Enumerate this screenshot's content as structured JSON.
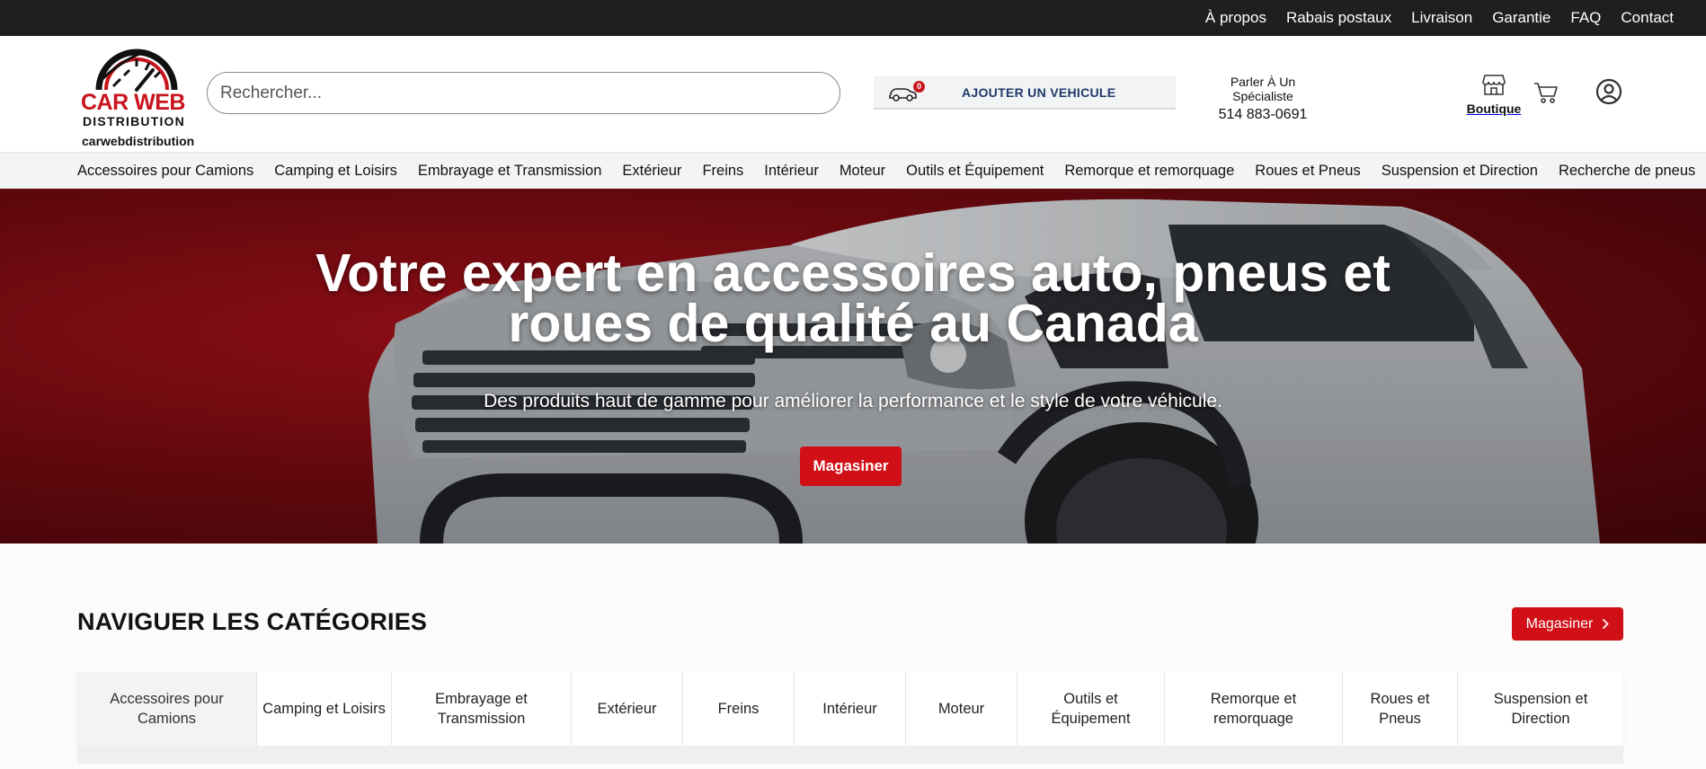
{
  "topbar": {
    "links": [
      "À propos",
      "Rabais postaux",
      "Livraison",
      "Garantie",
      "FAQ",
      "Contact"
    ]
  },
  "header": {
    "logo_line1": "CAR WEB",
    "logo_line2": "DISTRIBUTION",
    "site_name": "carwebdistribution",
    "search_placeholder": "Rechercher...",
    "vehicle_count": "0",
    "vehicle_label": "AJOUTER UN VEHICULE",
    "specialist_label": "Parler À Un Spécialiste",
    "specialist_phone": "514 883-0691",
    "boutique_label": "Boutique"
  },
  "category_nav": [
    "Accessoires pour Camions",
    "Camping et Loisirs",
    "Embrayage et Transmission",
    "Extérieur",
    "Freins",
    "Intérieur",
    "Moteur",
    "Outils et Équipement",
    "Remorque et remorquage",
    "Roues et Pneus",
    "Suspension et Direction",
    "Recherche de pneus"
  ],
  "hero": {
    "title_line1": "Votre expert en accessoires auto, pneus et",
    "title_line2": "roues de qualité au Canada",
    "subtitle": "Des produits haut de gamme pour améliorer la performance et le style de votre véhicule.",
    "cta": "Magasiner"
  },
  "browse": {
    "title": "NAVIGUER LES CATÉGORIES",
    "button": "Magasiner",
    "tabs": [
      "Accessoires pour Camions",
      "Camping et Loisirs",
      "Embrayage et Transmission",
      "Extérieur",
      "Freins",
      "Intérieur",
      "Moteur",
      "Outils et Équipement",
      "Remorque et remorquage",
      "Roues et Pneus",
      "Suspension et Direction"
    ],
    "active_tab": 0
  },
  "colors": {
    "accent_red": "#d10f17",
    "topbar_bg": "#1f1f1f",
    "vehicle_text": "#1f3a6b"
  }
}
